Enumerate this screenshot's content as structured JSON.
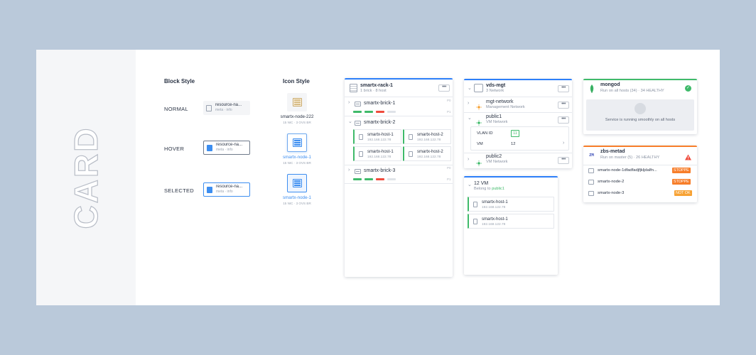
{
  "side": {
    "title": "CARD"
  },
  "block_style": {
    "heading": "Block Style",
    "states": [
      {
        "label": "NORMAL",
        "name": "resource-na...",
        "meta": "meta · info"
      },
      {
        "label": "HOVER",
        "name": "resource-na...",
        "meta": "meta · info"
      },
      {
        "label": "SELECTED",
        "name": "resource-na...",
        "meta": "meta · info"
      }
    ]
  },
  "icon_style": {
    "heading": "Icon Style",
    "items": [
      {
        "name": "smartx-node-222",
        "meta": "15 NIC · 3 OVS BR"
      },
      {
        "name": "smartx-node-1",
        "meta": "15 NIC · 3 OVS BR"
      },
      {
        "name": "smartx-node-1",
        "meta": "15 NIC · 3 OVS BR"
      }
    ]
  },
  "rack": {
    "title": "smartx-rack-1",
    "meta": "1 brick · 8 host",
    "bricks": [
      {
        "name": "smartx-brick-1",
        "top": "P0",
        "bottom": "P1"
      },
      {
        "name": "smartx-brick-2"
      },
      {
        "name": "smartx-brick-3",
        "top": "P0",
        "bottom": "P1"
      }
    ],
    "hosts": [
      {
        "name": "smartx-host-1",
        "ip": "192.168.122.78"
      },
      {
        "name": "smartx-host-2",
        "ip": "192.168.122.78"
      },
      {
        "name": "smartx-host-1",
        "ip": "192.168.122.78"
      },
      {
        "name": "smartx-host-2",
        "ip": "192.168.122.78"
      }
    ]
  },
  "network": {
    "title": "vds-mgt",
    "meta": "3 Network",
    "items": [
      {
        "name": "mgt-network",
        "type": "Management Network"
      },
      {
        "name": "public1",
        "type": "VM Network"
      },
      {
        "name": "public2",
        "type": "VM Network"
      }
    ],
    "detail": {
      "vlan_label": "VLAN ID",
      "vlan_value": "11",
      "vm_label": "VM",
      "vm_value": "12"
    }
  },
  "vm_panel": {
    "title": "12 VM",
    "belong_prefix": "Belong to",
    "belong_link": "public1",
    "hosts": [
      {
        "name": "smartx-host-1",
        "ip": "192.168.122.78"
      },
      {
        "name": "smartx-host-1",
        "ip": "192.168.122.78"
      }
    ]
  },
  "mongod": {
    "title": "mongod",
    "meta": "Run on all hosts (34) · 34 HEALTHY",
    "message": "Service is running smoothly on all hosts"
  },
  "zbs": {
    "badge": "ZM",
    "title": "zbs-metad",
    "meta": "Run on master (5) · 26 HEALTHY",
    "nodes": [
      {
        "name": "smartx-node-1dfadfadjfjkljdalfn...",
        "status": "STOPPE"
      },
      {
        "name": "smartx-node-2",
        "status": "STOPPE"
      },
      {
        "name": "smartx-node-3",
        "status": "NOT OK"
      }
    ]
  },
  "colors": {
    "accent": "#2d7ff9",
    "healthy": "#3fba6a",
    "warning": "#f77e2a",
    "error": "#ef4b3c",
    "bar_idle": "#dfe3e8"
  },
  "icons": {
    "more": "•••",
    "chevron_right": "›",
    "chevron_down": "⌄"
  }
}
